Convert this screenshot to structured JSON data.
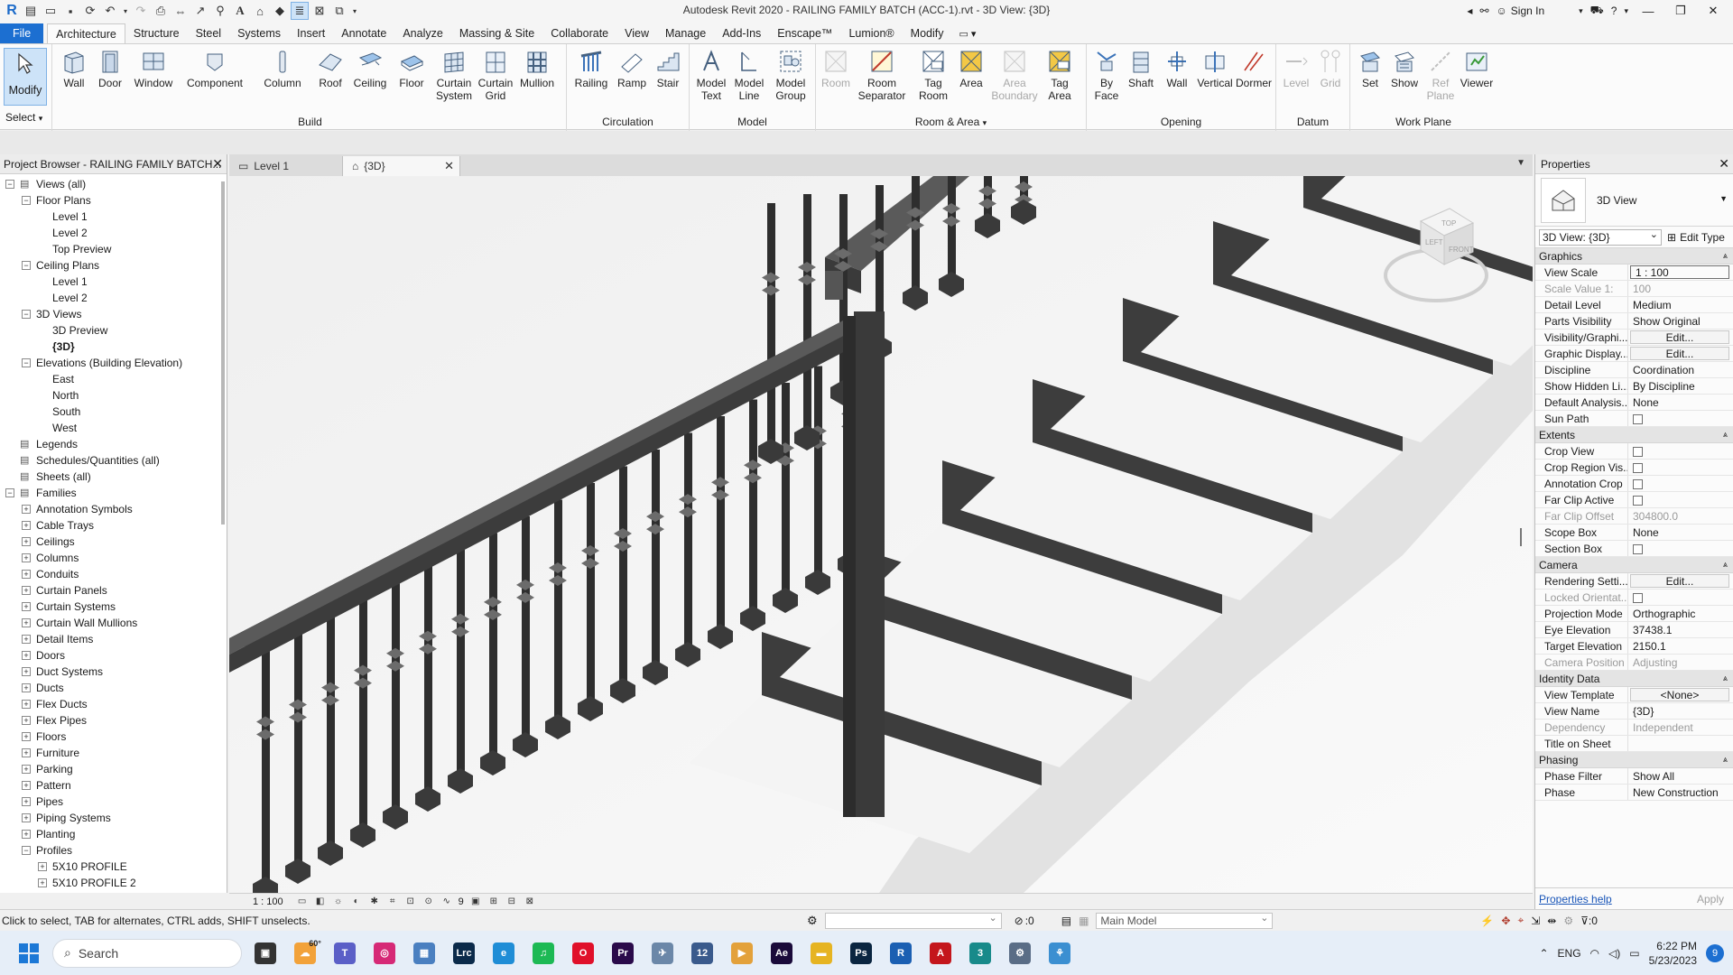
{
  "title_bar": {
    "title": "Autodesk Revit 2020 - RAILING FAMILY BATCH (ACC-1).rvt - 3D View: {3D}",
    "sign_in": "Sign In"
  },
  "ribbon_tabs": [
    {
      "label": "File"
    },
    {
      "label": "Architecture"
    },
    {
      "label": "Structure"
    },
    {
      "label": "Steel"
    },
    {
      "label": "Systems"
    },
    {
      "label": "Insert"
    },
    {
      "label": "Annotate"
    },
    {
      "label": "Analyze"
    },
    {
      "label": "Massing & Site"
    },
    {
      "label": "Collaborate"
    },
    {
      "label": "View"
    },
    {
      "label": "Manage"
    },
    {
      "label": "Add-Ins"
    },
    {
      "label": "Enscape™"
    },
    {
      "label": "Lumion®"
    },
    {
      "label": "Modify"
    }
  ],
  "ribbon": {
    "select": {
      "modify": "Modify",
      "label": "Select"
    },
    "build": {
      "label": "Build",
      "buttons": [
        "Wall",
        "Door",
        "Window",
        "Component",
        "Column",
        "Roof",
        "Ceiling",
        "Floor",
        "Curtain\nSystem",
        "Curtain\nGrid",
        "Mullion"
      ]
    },
    "circulation": {
      "label": "Circulation",
      "buttons": [
        "Railing",
        "Ramp",
        "Stair"
      ]
    },
    "model": {
      "label": "Model",
      "buttons": [
        "Model\nText",
        "Model\nLine",
        "Model\nGroup"
      ]
    },
    "room_area": {
      "label": "Room & Area",
      "buttons": [
        "Room",
        "Room\nSeparator",
        "Tag\nRoom",
        "Area",
        "Area\nBoundary",
        "Tag\nArea"
      ]
    },
    "opening": {
      "label": "Opening",
      "buttons": [
        "By\nFace",
        "Shaft",
        "Wall",
        "Vertical",
        "Dormer"
      ]
    },
    "datum": {
      "label": "Datum",
      "buttons": [
        "Level",
        "Grid"
      ]
    },
    "work_plane": {
      "label": "Work Plane",
      "buttons": [
        "Set",
        "Show",
        "Ref\nPlane",
        "Viewer"
      ]
    }
  },
  "project_browser": {
    "title": "Project Browser - RAILING FAMILY BATCH...",
    "nodes": [
      {
        "label": "Views (all)",
        "tog": "−"
      },
      {
        "label": "Floor Plans",
        "tog": "−"
      },
      {
        "label": "Level 1"
      },
      {
        "label": "Level 2"
      },
      {
        "label": "Top Preview"
      },
      {
        "label": "Ceiling Plans",
        "tog": "−"
      },
      {
        "label": "Level 1"
      },
      {
        "label": "Level 2"
      },
      {
        "label": "3D Views",
        "tog": "−"
      },
      {
        "label": "3D Preview"
      },
      {
        "label": "{3D}"
      },
      {
        "label": "Elevations (Building Elevation)",
        "tog": "−"
      },
      {
        "label": "East"
      },
      {
        "label": "North"
      },
      {
        "label": "South"
      },
      {
        "label": "West"
      },
      {
        "label": "Legends"
      },
      {
        "label": "Schedules/Quantities (all)"
      },
      {
        "label": "Sheets (all)"
      },
      {
        "label": "Families",
        "tog": "−"
      },
      {
        "label": "Annotation Symbols",
        "tog": "+"
      },
      {
        "label": "Cable Trays",
        "tog": "+"
      },
      {
        "label": "Ceilings",
        "tog": "+"
      },
      {
        "label": "Columns",
        "tog": "+"
      },
      {
        "label": "Conduits",
        "tog": "+"
      },
      {
        "label": "Curtain Panels",
        "tog": "+"
      },
      {
        "label": "Curtain Systems",
        "tog": "+"
      },
      {
        "label": "Curtain Wall Mullions",
        "tog": "+"
      },
      {
        "label": "Detail Items",
        "tog": "+"
      },
      {
        "label": "Doors",
        "tog": "+"
      },
      {
        "label": "Duct Systems",
        "tog": "+"
      },
      {
        "label": "Ducts",
        "tog": "+"
      },
      {
        "label": "Flex Ducts",
        "tog": "+"
      },
      {
        "label": "Flex Pipes",
        "tog": "+"
      },
      {
        "label": "Floors",
        "tog": "+"
      },
      {
        "label": "Furniture",
        "tog": "+"
      },
      {
        "label": "Parking",
        "tog": "+"
      },
      {
        "label": "Pattern",
        "tog": "+"
      },
      {
        "label": "Pipes",
        "tog": "+"
      },
      {
        "label": "Piping Systems",
        "tog": "+"
      },
      {
        "label": "Planting",
        "tog": "+"
      },
      {
        "label": "Profiles",
        "tog": "−"
      },
      {
        "label": "5X10 PROFILE",
        "tog": "+"
      },
      {
        "label": "5X10 PROFILE 2",
        "tog": "+"
      }
    ]
  },
  "view_tabs": [
    {
      "label": "Level 1"
    },
    {
      "label": "{3D}"
    }
  ],
  "view_cube": {
    "top": "TOP",
    "front": "FRONT",
    "left": "LEFT"
  },
  "view_control": {
    "scale": "1 : 100",
    "count": "9"
  },
  "properties": {
    "title": "Properties",
    "type_name": "3D View",
    "instance": "3D View: {3D}",
    "edit_type": "Edit Type",
    "sections": [
      {
        "name": "Graphics",
        "rows": [
          {
            "k": "View Scale",
            "v": "1 : 100",
            "style": "box"
          },
          {
            "k": "Scale Value    1:",
            "v": "100",
            "dis": true
          },
          {
            "k": "Detail Level",
            "v": "Medium"
          },
          {
            "k": "Parts Visibility",
            "v": "Show Original"
          },
          {
            "k": "Visibility/Graphi...",
            "v": "Edit...",
            "style": "btn"
          },
          {
            "k": "Graphic Display...",
            "v": "Edit...",
            "style": "btn"
          },
          {
            "k": "Discipline",
            "v": "Coordination"
          },
          {
            "k": "Show Hidden Li...",
            "v": "By Discipline"
          },
          {
            "k": "Default Analysis...",
            "v": "None"
          },
          {
            "k": "Sun Path",
            "v": "",
            "style": "cb"
          }
        ]
      },
      {
        "name": "Extents",
        "rows": [
          {
            "k": "Crop View",
            "v": "",
            "style": "cb"
          },
          {
            "k": "Crop Region Vis...",
            "v": "",
            "style": "cb"
          },
          {
            "k": "Annotation Crop",
            "v": "",
            "style": "cb"
          },
          {
            "k": "Far Clip Active",
            "v": "",
            "style": "cb"
          },
          {
            "k": "Far Clip Offset",
            "v": "304800.0",
            "dis": true
          },
          {
            "k": "Scope Box",
            "v": "None"
          },
          {
            "k": "Section Box",
            "v": "",
            "style": "cb"
          }
        ]
      },
      {
        "name": "Camera",
        "rows": [
          {
            "k": "Rendering Setti...",
            "v": "Edit...",
            "style": "btn"
          },
          {
            "k": "Locked Orientat...",
            "v": "",
            "style": "cb",
            "dis": true
          },
          {
            "k": "Projection Mode",
            "v": "Orthographic"
          },
          {
            "k": "Eye Elevation",
            "v": "37438.1"
          },
          {
            "k": "Target Elevation",
            "v": "2150.1"
          },
          {
            "k": "Camera Position",
            "v": "Adjusting",
            "dis": true
          }
        ]
      },
      {
        "name": "Identity Data",
        "rows": [
          {
            "k": "View Template",
            "v": "<None>",
            "style": "btn"
          },
          {
            "k": "View Name",
            "v": "{3D}"
          },
          {
            "k": "Dependency",
            "v": "Independent",
            "dis": true
          },
          {
            "k": "Title on Sheet",
            "v": ""
          }
        ]
      },
      {
        "name": "Phasing",
        "rows": [
          {
            "k": "Phase Filter",
            "v": "Show All"
          },
          {
            "k": "Phase",
            "v": "New Construction"
          }
        ]
      }
    ],
    "help": "Properties help",
    "apply": "Apply"
  },
  "status_bar": {
    "text": "Click to select, TAB for alternates, CTRL adds, SHIFT unselects.",
    "count": ":0",
    "model": "Main Model",
    "filter_count": ":0"
  },
  "taskbar": {
    "search": "Search",
    "time": "6:22 PM",
    "date": "5/23/2023",
    "lang": "ENG",
    "notifications": "9",
    "weather": "60°",
    "apps": [
      {
        "name": "task-view",
        "color": "#333333",
        "glyph": "▣"
      },
      {
        "name": "weather",
        "color": "#f2a23a",
        "glyph": "☁"
      },
      {
        "name": "teams",
        "color": "#5b5fc7",
        "glyph": "T"
      },
      {
        "name": "instagram",
        "color": "#d62976",
        "glyph": "◎"
      },
      {
        "name": "chart-app",
        "color": "#4a7fc0",
        "glyph": "▦"
      },
      {
        "name": "lightroom",
        "color": "#0b2a4a",
        "glyph": "Lrc"
      },
      {
        "name": "edge",
        "color": "#1f8dd6",
        "glyph": "e"
      },
      {
        "name": "spotify",
        "color": "#1db954",
        "glyph": "♫"
      },
      {
        "name": "opera",
        "color": "#e0102a",
        "glyph": "O"
      },
      {
        "name": "premiere",
        "color": "#2a0a4a",
        "glyph": "Pr"
      },
      {
        "name": "app-blue",
        "color": "#6b87a8",
        "glyph": "✈"
      },
      {
        "name": "app-calendar",
        "color": "#3a5a8c",
        "glyph": "12"
      },
      {
        "name": "media-player",
        "color": "#e3a13b",
        "glyph": "▶"
      },
      {
        "name": "after-effects",
        "color": "#1a0a3a",
        "glyph": "Ae"
      },
      {
        "name": "file-explorer",
        "color": "#e6b422",
        "glyph": "▬"
      },
      {
        "name": "photoshop",
        "color": "#0a2540",
        "glyph": "Ps"
      },
      {
        "name": "revit",
        "color": "#1b5fb2",
        "glyph": "R"
      },
      {
        "name": "autocad",
        "color": "#c4161c",
        "glyph": "A"
      },
      {
        "name": "3dsmax",
        "color": "#188a8a",
        "glyph": "3"
      },
      {
        "name": "settings",
        "color": "#5a6d86",
        "glyph": "⚙"
      },
      {
        "name": "network-app",
        "color": "#3b8fd1",
        "glyph": "⚘"
      }
    ]
  }
}
